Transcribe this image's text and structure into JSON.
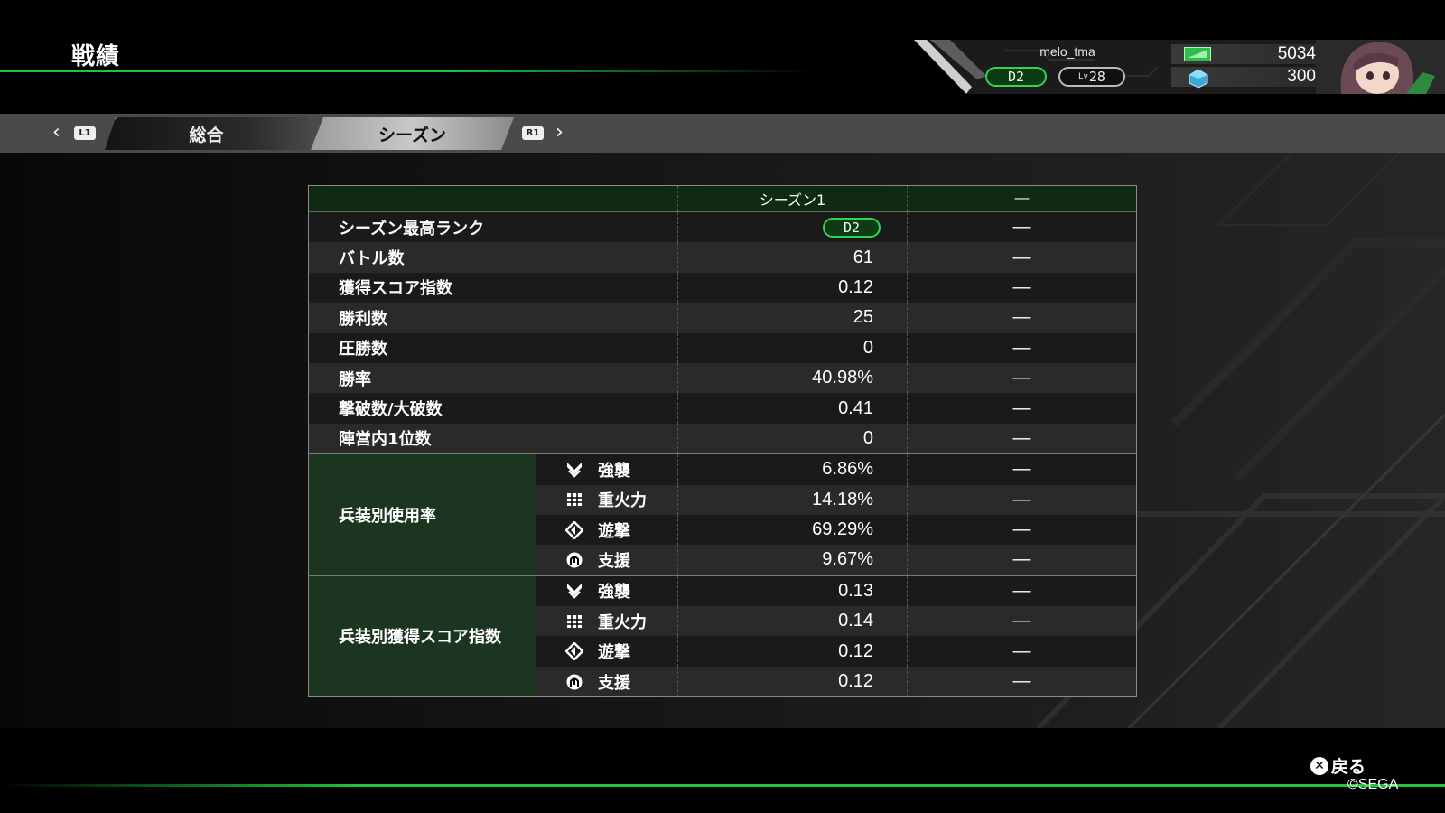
{
  "header": {
    "title": "戦績",
    "player": {
      "name": "melo_tma",
      "rank": "D2",
      "level_prefix": "Lv",
      "level": "28",
      "currency1": "5034",
      "currency2": "300"
    }
  },
  "tabs": {
    "left_button": "L1",
    "right_button": "R1",
    "items": [
      "総合",
      "シーズン"
    ],
    "active": "シーズン"
  },
  "table": {
    "columns": [
      "",
      "シーズン1",
      "—"
    ],
    "rows": [
      {
        "label": "シーズン最高ランク",
        "s1": "D2",
        "s2": "—"
      },
      {
        "label": "バトル数",
        "s1": "61",
        "s2": "—"
      },
      {
        "label": "獲得スコア指数",
        "s1": "0.12",
        "s2": "—"
      },
      {
        "label": "勝利数",
        "s1": "25",
        "s2": "—"
      },
      {
        "label": "圧勝数",
        "s1": "0",
        "s2": "—"
      },
      {
        "label": "勝率",
        "s1": "40.98%",
        "s2": "—"
      },
      {
        "label": "撃破数/大破数",
        "s1": "0.41",
        "s2": "—"
      },
      {
        "label": "陣営内1位数",
        "s1": "0",
        "s2": "—"
      }
    ],
    "groups": [
      {
        "label": "兵装別使用率",
        "rows": [
          {
            "icon": "assault-icon",
            "weapon": "強襲",
            "s1": "6.86%",
            "s2": "—"
          },
          {
            "icon": "heavy-icon",
            "weapon": "重火力",
            "s1": "14.18%",
            "s2": "—"
          },
          {
            "icon": "raid-icon",
            "weapon": "遊撃",
            "s1": "69.29%",
            "s2": "—"
          },
          {
            "icon": "support-icon",
            "weapon": "支援",
            "s1": "9.67%",
            "s2": "—"
          }
        ]
      },
      {
        "label": "兵装別獲得スコア指数",
        "rows": [
          {
            "icon": "assault-icon",
            "weapon": "強襲",
            "s1": "0.13",
            "s2": "—"
          },
          {
            "icon": "heavy-icon",
            "weapon": "重火力",
            "s1": "0.14",
            "s2": "—"
          },
          {
            "icon": "raid-icon",
            "weapon": "遊撃",
            "s1": "0.12",
            "s2": "—"
          },
          {
            "icon": "support-icon",
            "weapon": "支援",
            "s1": "0.12",
            "s2": "—"
          }
        ]
      }
    ]
  },
  "footer": {
    "back_label": "戻る",
    "copyright": "©SEGA"
  },
  "colors": {
    "accent": "#1fc63b",
    "group_bg": "#1c3520",
    "header_bg": "#0f2a10"
  }
}
